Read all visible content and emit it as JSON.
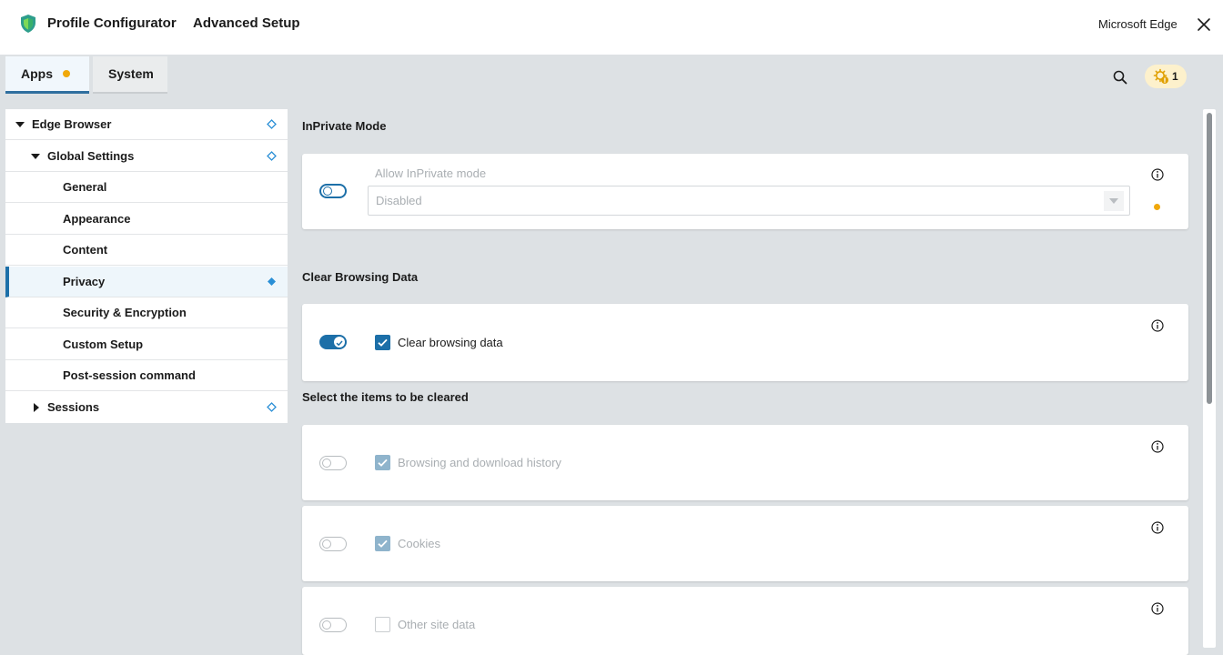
{
  "header": {
    "app_name": "Profile Configurator",
    "subtitle": "Advanced Setup",
    "target_app": "Microsoft Edge",
    "close_icon": "close-icon",
    "logo_icon": "shield-icon"
  },
  "tabs": [
    {
      "label": "Apps",
      "active": true,
      "has_indicator": true
    },
    {
      "label": "System",
      "active": false
    }
  ],
  "toolbar": {
    "search_icon": "search-icon",
    "notification_icon": "gear-alert-icon",
    "notification_count": "1"
  },
  "sidebar": {
    "items": [
      {
        "label": "Edge Browser",
        "level": 0,
        "expanded": true,
        "modified": true
      },
      {
        "label": "Global Settings",
        "level": 1,
        "expanded": true,
        "modified": true
      },
      {
        "label": "General",
        "level": 2
      },
      {
        "label": "Appearance",
        "level": 2
      },
      {
        "label": "Content",
        "level": 2
      },
      {
        "label": "Privacy",
        "level": 2,
        "selected": true,
        "modified": true
      },
      {
        "label": "Security & Encryption",
        "level": 2
      },
      {
        "label": "Custom Setup",
        "level": 2
      },
      {
        "label": "Post-session command",
        "level": 2
      },
      {
        "label": "Sessions",
        "level": 1,
        "expanded": false,
        "modified": true
      }
    ]
  },
  "main": {
    "inprivate": {
      "section_title": "InPrivate Mode",
      "field_label": "Allow InPrivate mode",
      "select_value": "Disabled",
      "enabled": false
    },
    "clear_data": {
      "section_title": "Clear Browsing Data",
      "label": "Clear browsing data",
      "enabled": true,
      "checked": true
    },
    "items_section_title": "Select the items to be cleared",
    "items": [
      {
        "label": "Browsing and download history",
        "checked": true
      },
      {
        "label": "Cookies",
        "checked": true
      },
      {
        "label": "Other site data",
        "checked": false
      }
    ]
  },
  "colors": {
    "accent": "#1c6fa8",
    "warning": "#f0a80a",
    "background": "#dde1e4"
  }
}
